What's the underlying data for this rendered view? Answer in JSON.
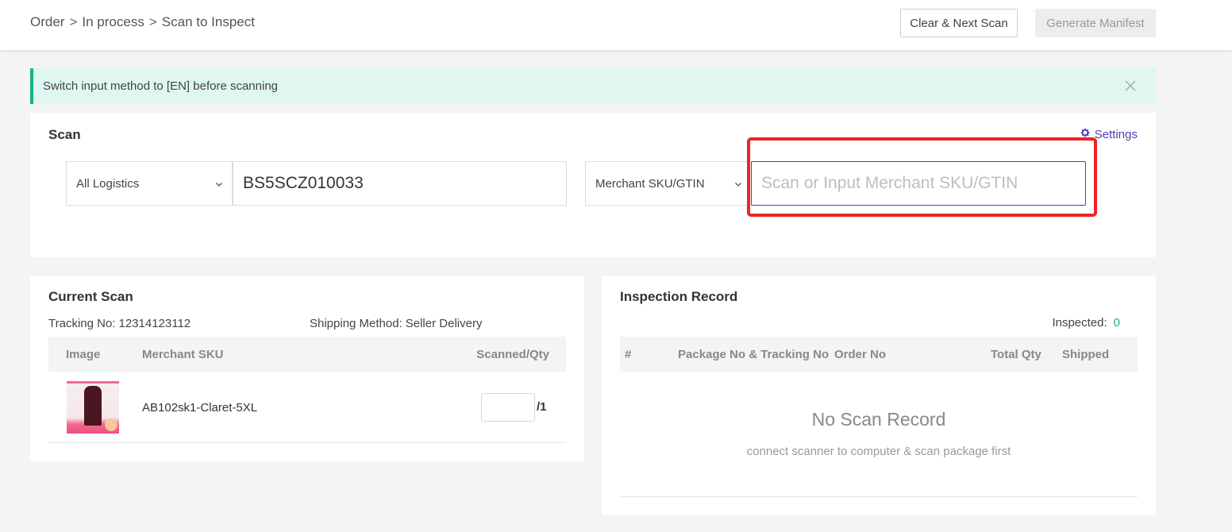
{
  "header": {
    "breadcrumb": [
      "Order",
      "In process",
      "Scan to Inspect"
    ],
    "breadcrumb_separator": ">",
    "clear_next_label": "Clear & Next Scan",
    "generate_manifest_label": "Generate Manifest"
  },
  "alert": {
    "message": "Switch input method to [EN] before scanning",
    "close_icon": "close-icon",
    "accent_color": "#0fb58a"
  },
  "scan": {
    "title": "Scan",
    "settings_label": "Settings",
    "settings_icon": "gear-icon",
    "logistics_select": {
      "selected": "All Logistics"
    },
    "tracking_input": {
      "value": "BS5SCZ010033"
    },
    "sku_type_select": {
      "selected": "Merchant SKU/GTIN"
    },
    "sku_input": {
      "value": "",
      "placeholder": "Scan or Input Merchant SKU/GTIN"
    }
  },
  "current_scan": {
    "title": "Current Scan",
    "tracking_label": "Tracking No:",
    "tracking_value": "12314123112",
    "shipping_label": "Shipping Method:",
    "shipping_value": "Seller Delivery",
    "columns": [
      "Image",
      "Merchant SKU",
      "Scanned/Qty"
    ],
    "rows": [
      {
        "image": "product-thumbnail",
        "sku": "AB102sk1-Claret-5XL",
        "scanned": "",
        "qty": "/1"
      }
    ]
  },
  "inspection_record": {
    "title": "Inspection Record",
    "inspected_label": "Inspected:",
    "inspected_count": "0",
    "columns": [
      "#",
      "Package No & Tracking No",
      "Order No",
      "Total Qty",
      "Shipped"
    ],
    "empty_title": "No Scan Record",
    "empty_subtitle": "connect scanner to computer & scan package first"
  },
  "colors": {
    "brand_purple": "#4a3fb5",
    "success_green": "#0fb58a",
    "highlight_red": "#f02424"
  }
}
